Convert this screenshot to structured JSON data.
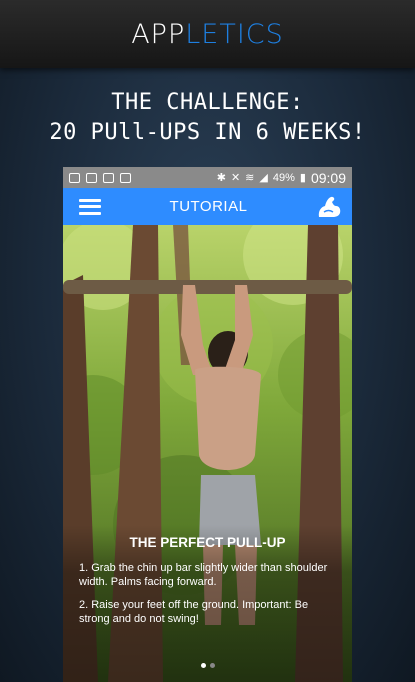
{
  "brand": {
    "part1": "APP",
    "part2": "LETICS",
    "color_primary": "#ffffff",
    "color_accent": "#1e7fe0"
  },
  "headline": {
    "line1": "THE CHALLENGE:",
    "line2": "20 PUll-UPS IN 6 WEEKS!"
  },
  "phone": {
    "statusbar": {
      "battery": "49%",
      "time": "09:09"
    },
    "appbar": {
      "title": "TUTORIAL",
      "menu_icon": "hamburger-menu-icon",
      "action_icon": "flexed-biceps-icon",
      "color": "#2e8cff"
    },
    "tutorial": {
      "title": "THE PERFECT PULL-UP",
      "step1": "1. Grab the chin up bar slightly wider than shoulder width. Palms facing forward.",
      "step2": "2. Raise your feet off the ground. Important: Be strong and do not swing!"
    },
    "pager": {
      "pages": 2,
      "current": 1
    }
  }
}
